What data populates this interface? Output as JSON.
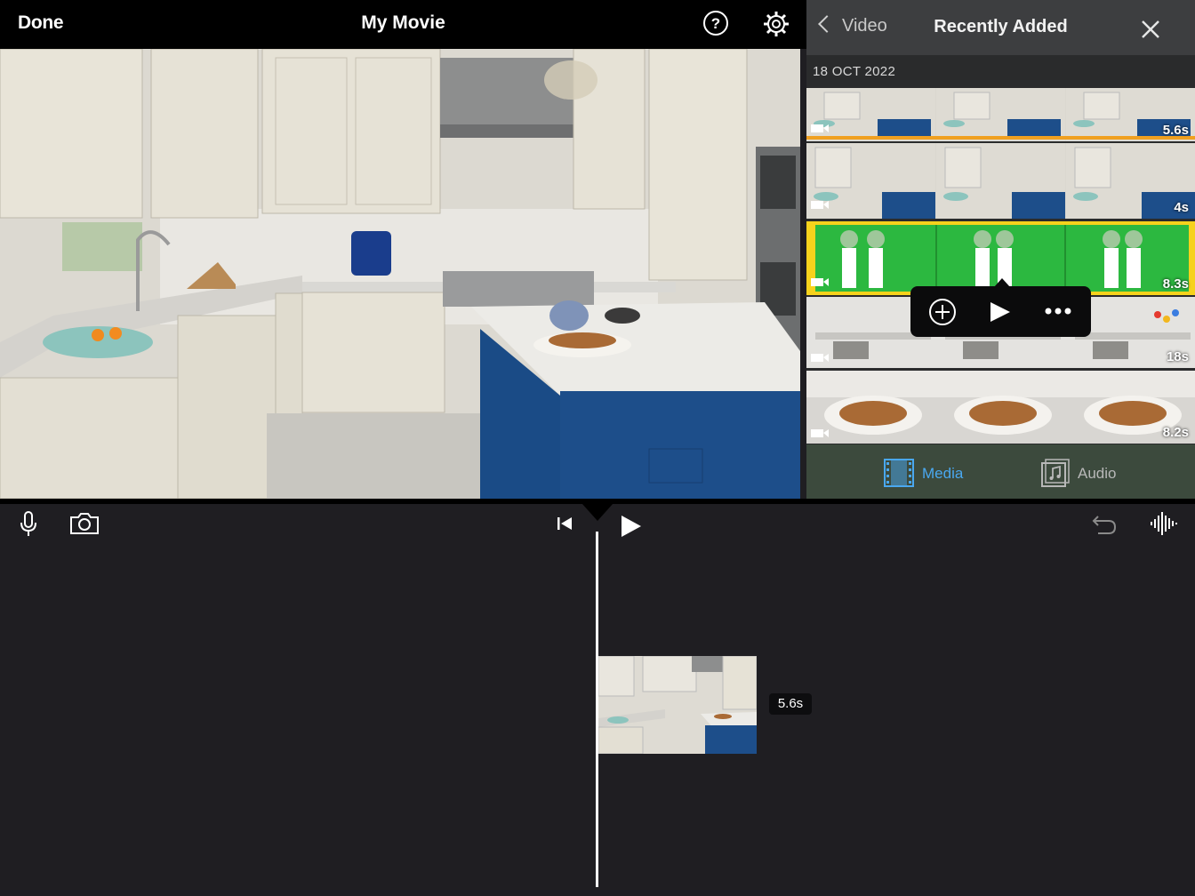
{
  "topbar": {
    "done_label": "Done",
    "title": "My Movie",
    "help_icon": "question-circle-icon",
    "settings_icon": "gear-icon"
  },
  "browser": {
    "back_label": "Video",
    "title": "Recently Added",
    "close_icon": "close-icon",
    "date": "18 OCT 2022",
    "clips": [
      {
        "duration": "5.6s"
      },
      {
        "duration": "4s"
      },
      {
        "duration": "8.3s"
      },
      {
        "duration": "18s"
      },
      {
        "duration": "8.2s"
      }
    ],
    "tabs": {
      "media": "Media",
      "audio": "Audio"
    }
  },
  "timeline": {
    "clip_duration": "5.6s"
  },
  "colors": {
    "accent_yellow": "#f6d21c",
    "accent_orange": "#f0a020",
    "media_blue": "#4aa8f0",
    "green_screen": "#2cb840",
    "island_blue": "#1d4e8a"
  }
}
